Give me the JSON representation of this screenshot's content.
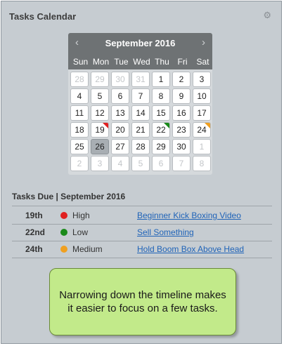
{
  "panel": {
    "title": "Tasks Calendar",
    "gear_icon": "gear-icon"
  },
  "calendar": {
    "month_label": "September 2016",
    "prev_icon": "‹",
    "next_icon": "›",
    "days_of_week": [
      "Sun",
      "Mon",
      "Tue",
      "Wed",
      "Thu",
      "Fri",
      "Sat"
    ],
    "weeks": [
      [
        "28",
        "29",
        "30",
        "31",
        "1",
        "2",
        "3"
      ],
      [
        "4",
        "5",
        "6",
        "7",
        "8",
        "9",
        "10"
      ],
      [
        "11",
        "12",
        "13",
        "14",
        "15",
        "16",
        "17"
      ],
      [
        "18",
        "19",
        "20",
        "21",
        "22",
        "23",
        "24"
      ],
      [
        "25",
        "26",
        "27",
        "28",
        "29",
        "30",
        "1"
      ],
      [
        "2",
        "3",
        "4",
        "5",
        "6",
        "7",
        "8"
      ]
    ],
    "selected_day": "26",
    "flags": {
      "19": "#e02020",
      "22": "#1a8a1a",
      "24": "#f0a020"
    }
  },
  "tasks": {
    "title": "Tasks Due  |  September 2016",
    "rows": [
      {
        "day": "19th",
        "priority": "High",
        "color": "#e02020",
        "task": "Beginner Kick Boxing Video"
      },
      {
        "day": "22nd",
        "priority": "Low",
        "color": "#1a8a1a",
        "task": "Sell Something"
      },
      {
        "day": "24th",
        "priority": "Medium",
        "color": "#f0a020",
        "task": "Hold Boom Box Above Head"
      }
    ]
  },
  "callout": {
    "text": "Narrowing down the timeline makes it easier to focus on a few tasks."
  }
}
